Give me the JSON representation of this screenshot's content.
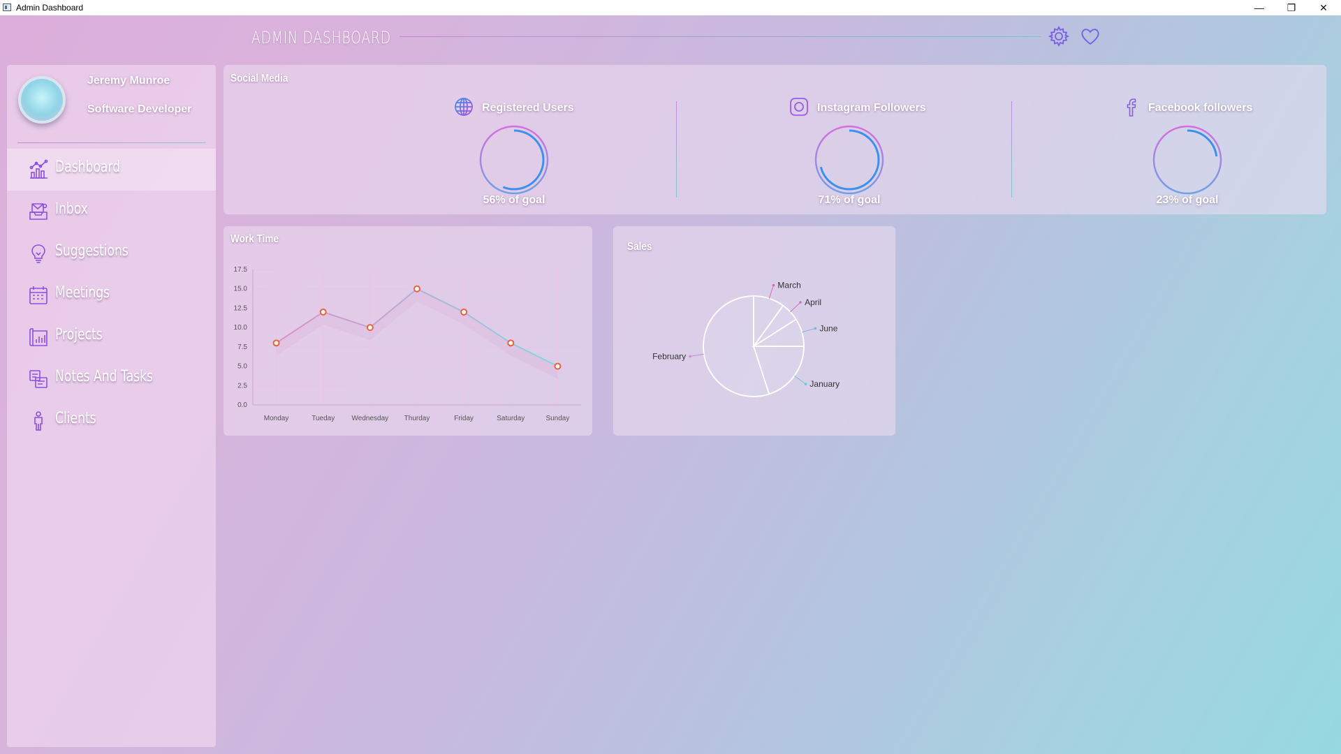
{
  "window": {
    "title": "Admin Dashboard",
    "minimize": "—",
    "restore": "❐",
    "close": "✕"
  },
  "header": {
    "title": "ADMIN DASHBOARD",
    "icons": [
      "gear-icon",
      "heart-icon"
    ]
  },
  "profile": {
    "name": "Jeremy Munroe",
    "role": "Software Developer"
  },
  "sidebar": {
    "items": [
      {
        "label": "Dashboard",
        "icon": "dashboard-chart-icon",
        "active": true
      },
      {
        "label": "Inbox",
        "icon": "inbox-icon",
        "active": false
      },
      {
        "label": "Suggestions",
        "icon": "lightbulb-icon",
        "active": false
      },
      {
        "label": "Meetings",
        "icon": "calendar-icon",
        "active": false
      },
      {
        "label": "Projects",
        "icon": "projects-icon",
        "active": false
      },
      {
        "label": "Notes And Tasks",
        "icon": "notes-icon",
        "active": false
      },
      {
        "label": "Clients",
        "icon": "person-icon",
        "active": false
      }
    ]
  },
  "social": {
    "title": "Social Media",
    "items": [
      {
        "label": "Registered Users",
        "icon": "globe-icon",
        "goal_percent": 56,
        "goal_text": "56% of goal"
      },
      {
        "label": "Instagram Followers",
        "icon": "instagram-icon",
        "goal_percent": 71,
        "goal_text": "71% of goal"
      },
      {
        "label": "Facebook followers",
        "icon": "facebook-icon",
        "goal_percent": 23,
        "goal_text": "23% of goal"
      }
    ]
  },
  "worktime": {
    "title": "Work Time"
  },
  "sales": {
    "title": "Sales"
  },
  "colors": {
    "accent_purple": "#b14ee0",
    "accent_blue": "#3d8ff0",
    "line_point": "#e8633a",
    "ring_gradient_start": "#d76ee0",
    "ring_gradient_end": "#6ea0e8"
  },
  "chart_data": [
    {
      "type": "line",
      "title": "Work Time",
      "categories": [
        "Monday",
        "Tueday",
        "Wednesday",
        "Thurday",
        "Friday",
        "Saturday",
        "Sunday"
      ],
      "series": [
        {
          "values": [
            8,
            12,
            10,
            15,
            12,
            8,
            5
          ]
        }
      ],
      "ylim": [
        0,
        17.5
      ],
      "yticks": [
        "0.0",
        "2.5",
        "5.0",
        "7.5",
        "10.0",
        "12.5",
        "15.0",
        "17.5"
      ],
      "grid": true
    },
    {
      "type": "pie",
      "title": "Sales",
      "labels": [
        "January",
        "February",
        "March",
        "April",
        "June"
      ],
      "values": [
        20,
        55,
        10,
        6,
        9
      ]
    }
  ]
}
